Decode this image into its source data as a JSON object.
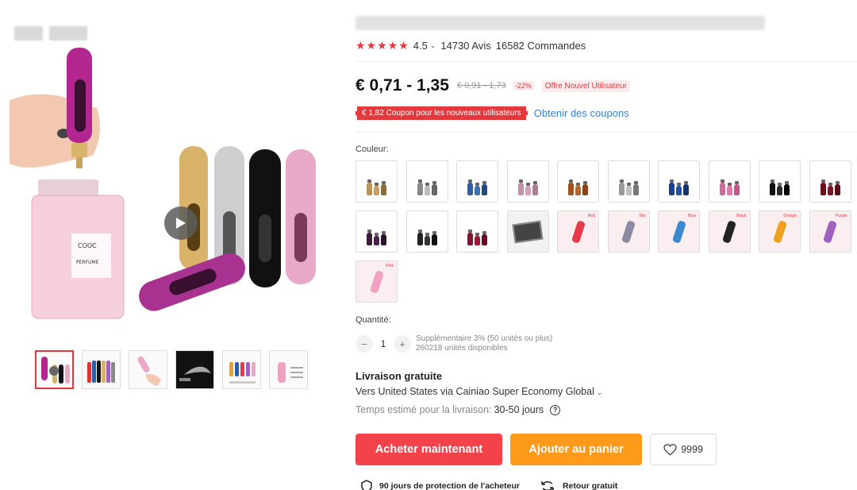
{
  "product": {
    "rating": "4.5",
    "reviews": "14730 Avis",
    "orders": "16582 Commandes"
  },
  "price": {
    "range": "€ 0,71 - 1,35",
    "original": "€ 0,91 - 1,73",
    "discount": "-22%",
    "offer": "Offre Nouvel Utilisateur"
  },
  "coupon": {
    "label": "€ 1,82 Coupon pour les nouveaux utilisateurs",
    "link": "Obtenir des coupons"
  },
  "color_label": "Couleur:",
  "colors": [
    {
      "type": "bottles",
      "c": [
        "#b8935a",
        "#c9a062",
        "#8a6a3a"
      ]
    },
    {
      "type": "bottles",
      "c": [
        "#888",
        "#bbb",
        "#666"
      ]
    },
    {
      "type": "bottles",
      "c": [
        "#2c5ea8",
        "#3f6fb4",
        "#1f4a86"
      ]
    },
    {
      "type": "bottles",
      "c": [
        "#c48fa6",
        "#d0a0b3",
        "#b07a93"
      ]
    },
    {
      "type": "bottles",
      "c": [
        "#a0521f",
        "#b76428",
        "#8a4318"
      ]
    },
    {
      "type": "bottles",
      "c": [
        "#999",
        "#c0c0c0",
        "#777"
      ]
    },
    {
      "type": "bottles",
      "c": [
        "#1b3f8a",
        "#25509e",
        "#153370"
      ]
    },
    {
      "type": "bottles",
      "c": [
        "#d46a9b",
        "#e07aa8",
        "#c0588a"
      ]
    },
    {
      "type": "bottles",
      "c": [
        "#111",
        "#2a2a2a",
        "#000"
      ]
    },
    {
      "type": "bottles",
      "c": [
        "#6a0e1c",
        "#7e1424",
        "#560b16"
      ]
    },
    {
      "type": "bottles",
      "c": [
        "#3a1e3a",
        "#4a244a",
        "#2a162a"
      ]
    },
    {
      "type": "bottles",
      "c": [
        "#222",
        "#333",
        "#111"
      ]
    },
    {
      "type": "bottles",
      "c": [
        "#8a1030",
        "#a01838",
        "#6a0c24"
      ]
    },
    {
      "type": "box"
    },
    {
      "type": "pic",
      "c": "#e83a4a",
      "tag": "Red"
    },
    {
      "type": "pic",
      "c": "#8a8aa0",
      "tag": "Mix"
    },
    {
      "type": "pic",
      "c": "#3a8ad0",
      "tag": "Blue"
    },
    {
      "type": "pic",
      "c": "#222",
      "tag": "Black"
    },
    {
      "type": "pic",
      "c": "#f0a020",
      "tag": "Orange"
    },
    {
      "type": "pic",
      "c": "#a060c0",
      "tag": "Purple"
    },
    {
      "type": "pic",
      "c": "#f0a0c0",
      "tag": "Pink"
    }
  ],
  "quantity": {
    "label": "Quantité:",
    "value": "1",
    "minus": "−",
    "plus": "+",
    "note": "Supplémentaire 3% (50 unités ou plus)",
    "stock": "260218 unités disponibles"
  },
  "shipping": {
    "title": "Livraison gratuite",
    "line": "Vers United States via Cainiao Super Economy Global",
    "eta_label": "Temps estimé pour la livraison:",
    "eta_value": "30-50 jours"
  },
  "actions": {
    "buy": "Acheter maintenant",
    "cart": "Ajouter au panier",
    "wishlist_count": "9999"
  },
  "guarantees": {
    "protection": "90 jours de protection de l'acheteur",
    "return": "Retour gratuit"
  },
  "icons": [
    "star-icon",
    "play-icon",
    "heart-icon",
    "help-icon",
    "shield-icon",
    "return-icon",
    "chevron-down-icon"
  ],
  "accent": "#e4393c"
}
